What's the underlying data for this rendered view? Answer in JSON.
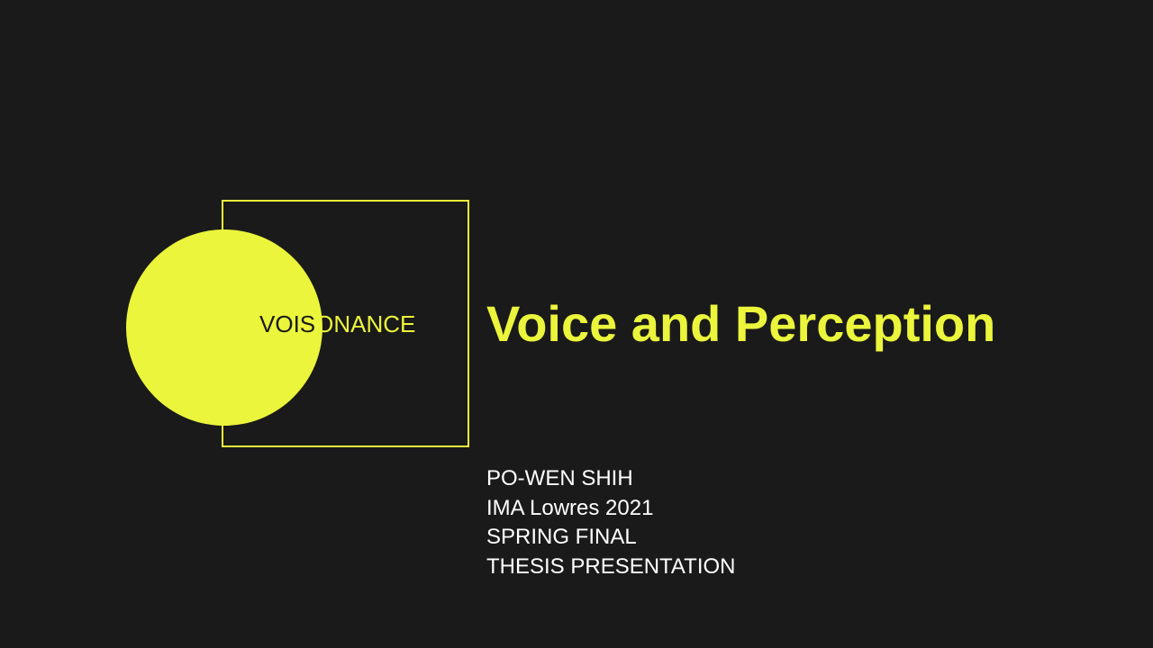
{
  "logo": {
    "word_part_dark": "VOIS",
    "word_part_light": "ONANCE"
  },
  "title": "Voice and Perception",
  "details": [
    "PO-WEN SHIH",
    "IMA Lowres 2021",
    "SPRING FINAL",
    "THESIS PRESENTATION"
  ],
  "colors": {
    "background": "#1a1a1a",
    "accent": "#ebf53b",
    "text": "#ffffff"
  }
}
